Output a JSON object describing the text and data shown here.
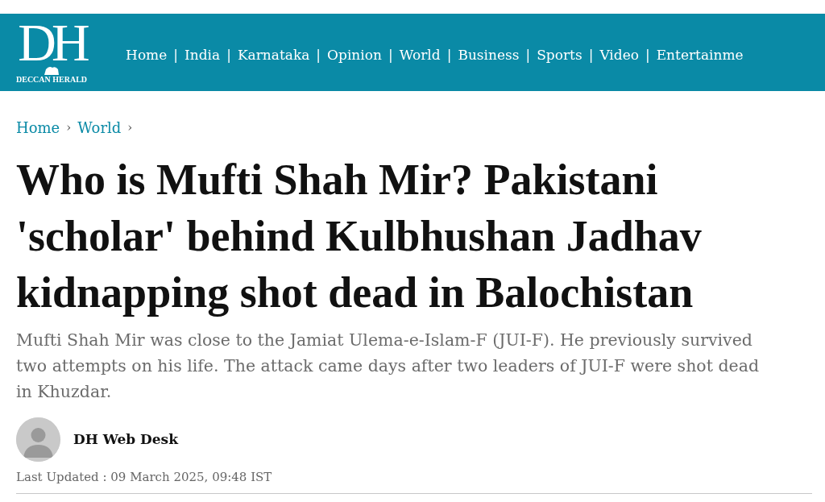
{
  "header": {
    "logo": {
      "initials": "DH",
      "name": "DECCAN HERALD"
    },
    "separator": "|",
    "nav": [
      {
        "label": "Home"
      },
      {
        "label": "India"
      },
      {
        "label": "Karnataka"
      },
      {
        "label": "Opinion"
      },
      {
        "label": "World"
      },
      {
        "label": "Business"
      },
      {
        "label": "Sports"
      },
      {
        "label": "Video"
      },
      {
        "label": "Entertainme"
      }
    ]
  },
  "breadcrumb": {
    "separator": "›",
    "items": [
      {
        "label": "Home"
      },
      {
        "label": "World"
      }
    ]
  },
  "article": {
    "headline": "Who is Mufti Shah Mir? Pakistani 'scholar' behind Kulbhushan Jadhav kidnapping shot dead in Balochistan",
    "summary": "Mufti Shah Mir was close to the Jamiat Ulema-e-Islam-F (JUI-F). He previously survived two attempts on his life. The attack came days after two leaders of JUI-F were shot dead in Khuzdar.",
    "author": "DH Web Desk",
    "updated": "Last Updated : 09 March 2025, 09:48 IST"
  }
}
